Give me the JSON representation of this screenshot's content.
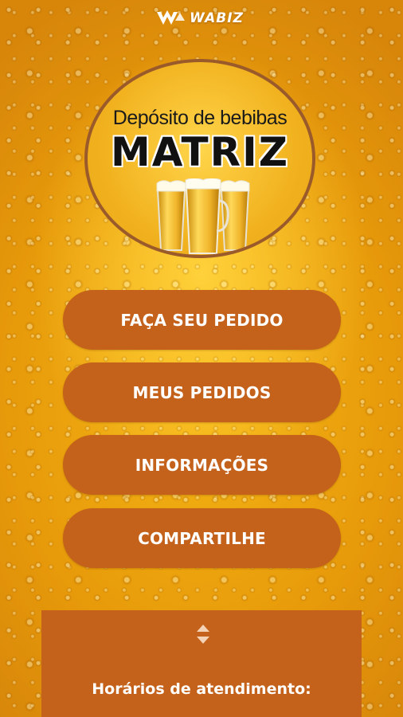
{
  "brand": {
    "name": "WABIZ",
    "icon": "wabiz-logo-icon"
  },
  "logo": {
    "subtitle": "Depósito de bebibas",
    "title": "MATRIZ",
    "image": "beer-glasses-icon",
    "colors": {
      "border": "#9a5a2a",
      "fill": "#f2b320"
    }
  },
  "menu": {
    "items": [
      {
        "label": "FAÇA SEU PEDIDO"
      },
      {
        "label": "MEUS PEDIDOS"
      },
      {
        "label": "INFORMAÇÕES"
      },
      {
        "label": "COMPARTILHE"
      }
    ],
    "color": "#c4611a"
  },
  "info": {
    "toggle_icon": "expand-collapse-icon",
    "hours_title": "Horários de atendimento:"
  },
  "theme": {
    "background": "#f0aa14",
    "accent": "#c4611a",
    "text": "#ffffff"
  }
}
